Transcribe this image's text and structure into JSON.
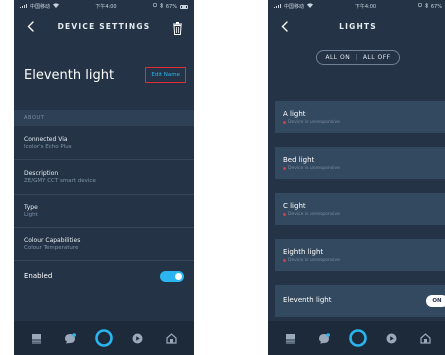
{
  "left": {
    "status": {
      "carrier": "中国移动",
      "time": "下午4:00",
      "battery": "67%"
    },
    "title": "DEVICE SETTINGS",
    "device_name": "Eleventh light",
    "edit_label": "Edit Name",
    "section": "ABOUT",
    "rows": [
      {
        "label": "Connected Via",
        "value": "Icolor's Echo Plus"
      },
      {
        "label": "Description",
        "value": "ZE/GMY CCT smart device"
      },
      {
        "label": "Type",
        "value": "Light"
      },
      {
        "label": "Colour Capabilities",
        "value": "Colour Temperature"
      }
    ],
    "enabled_label": "Enabled",
    "enabled": true
  },
  "right": {
    "status": {
      "carrier": "中国移动",
      "time": "下午4:00",
      "battery": "67%"
    },
    "title": "LIGHTS",
    "all_on": "ALL ON",
    "all_off": "ALL OFF",
    "lights": [
      {
        "name": "A light",
        "status": "Device is unresponsive"
      },
      {
        "name": "Bed light",
        "status": "Device is unresponsive"
      },
      {
        "name": "C light",
        "status": "Device is unresponsive"
      },
      {
        "name": "Eighth light",
        "status": "Device is unresponsive"
      }
    ],
    "eleventh": {
      "name": "Eleventh light",
      "badge": "ON"
    }
  },
  "colors": {
    "background": "#243446",
    "accent": "#2ab5f0",
    "highlight": "#e32b34",
    "card": "#33495f"
  },
  "tabbar_icons": [
    "home-icon",
    "communicate-icon",
    "alexa-icon",
    "play-icon",
    "devices-icon"
  ]
}
